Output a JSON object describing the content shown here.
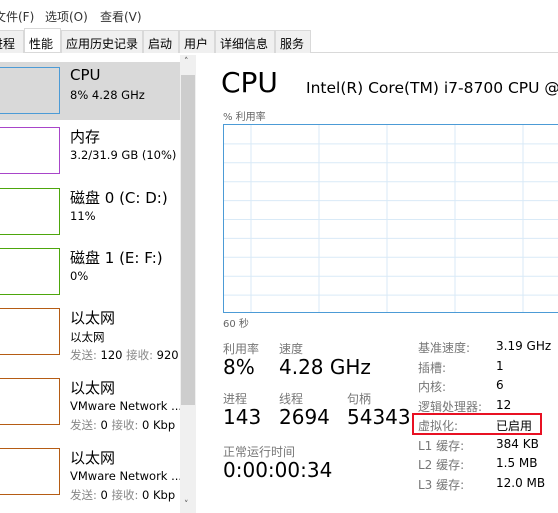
{
  "menu": [
    "文件(F)",
    "选项(O)",
    "查看(V)"
  ],
  "tabs": [
    {
      "label": "进程"
    },
    {
      "label": "性能",
      "active": true
    },
    {
      "label": "应用历史记录"
    },
    {
      "label": "启动"
    },
    {
      "label": "用户"
    },
    {
      "label": "详细信息"
    },
    {
      "label": "服务"
    }
  ],
  "sidebar": {
    "items": [
      {
        "title": "CPU",
        "sub": "8% 4.28 GHz",
        "color": "#4c9bd6",
        "selected": true
      },
      {
        "title": "内存",
        "sub": "3.2/31.9 GB (10%)",
        "color": "#a845c9"
      },
      {
        "title": "磁盘 0 (C: D:)",
        "sub": "11%",
        "color": "#4da60c"
      },
      {
        "title": "磁盘 1 (E: F:)",
        "sub": "0%",
        "color": "#4da60c"
      },
      {
        "title": "以太网",
        "sub": "以太网",
        "send_label": "发送:",
        "send": "120",
        "recv_label": "接收:",
        "recv": "920",
        "color": "#b55c14"
      },
      {
        "title": "以太网",
        "sub": "VMware Network ...",
        "send_label": "发送:",
        "send": "0",
        "recv_label": "接收:",
        "recv": "0 Kbp",
        "color": "#b55c14"
      },
      {
        "title": "以太网",
        "sub": "VMware Network ...",
        "send_label": "发送:",
        "send": "0",
        "recv_label": "接收:",
        "recv": "0 Kbp",
        "color": "#b55c14"
      }
    ]
  },
  "main": {
    "title": "CPU",
    "model": "Intel(R) Core(TM) i7-8700 CPU @",
    "graph_label": "% 利用率",
    "time_label": "60 秒",
    "stats": {
      "util_label": "利用率",
      "util": "8%",
      "speed_label": "速度",
      "speed": "4.28 GHz",
      "proc_label": "进程",
      "proc": "143",
      "thread_label": "线程",
      "thread": "2694",
      "handle_label": "句柄",
      "handle": "54343",
      "uptime_label": "正常运行时间",
      "uptime": "0:00:00:34"
    },
    "specs": [
      {
        "k": "基准速度:",
        "v": "3.19 GHz"
      },
      {
        "k": "插槽:",
        "v": "1"
      },
      {
        "k": "内核:",
        "v": "6"
      },
      {
        "k": "逻辑处理器:",
        "v": "12"
      },
      {
        "k": "虚拟化:",
        "v": "已启用",
        "highlight": true
      },
      {
        "k": "L1 缓存:",
        "v": "384 KB"
      },
      {
        "k": "L2 缓存:",
        "v": "1.5 MB"
      },
      {
        "k": "L3 缓存:",
        "v": "12.0 MB"
      }
    ],
    "highlight_color": "#e81123",
    "accent": "#4c9bd6"
  }
}
